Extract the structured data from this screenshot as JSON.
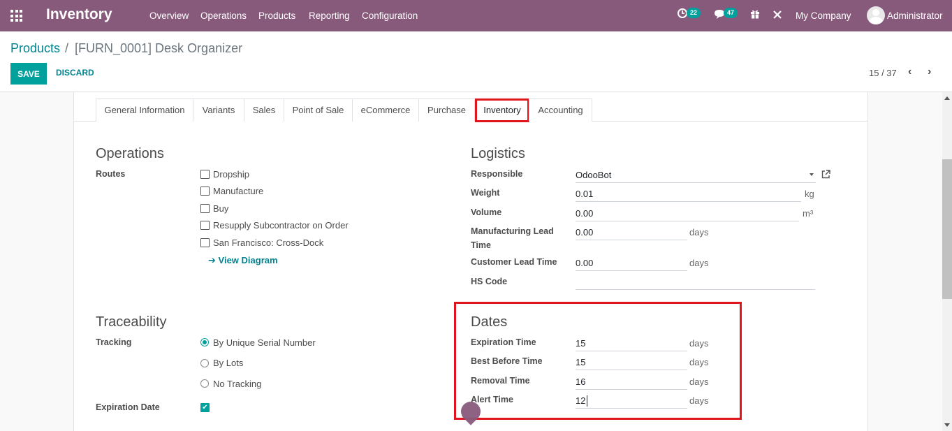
{
  "navbar": {
    "app_name": "Inventory",
    "menu": [
      "Overview",
      "Operations",
      "Products",
      "Reporting",
      "Configuration"
    ],
    "activity_badge": "22",
    "messages_badge": "47",
    "company": "My Company",
    "user": "Administrator"
  },
  "breadcrumb": {
    "parent": "Products",
    "separator": "/",
    "current": "[FURN_0001] Desk Organizer"
  },
  "buttons": {
    "save": "SAVE",
    "discard": "DISCARD"
  },
  "pager": {
    "text": "15 / 37",
    "prev": "‹",
    "next": "›"
  },
  "tabs": [
    "General Information",
    "Variants",
    "Sales",
    "Point of Sale",
    "eCommerce",
    "Purchase",
    "Inventory",
    "Accounting"
  ],
  "operations": {
    "title": "Operations",
    "routes_label": "Routes",
    "routes": [
      "Dropship",
      "Manufacture",
      "Buy",
      "Resupply Subcontractor on Order",
      "San Francisco: Cross-Dock"
    ],
    "view_diagram": "View Diagram"
  },
  "logistics": {
    "title": "Logistics",
    "responsible_label": "Responsible",
    "responsible_value": "OdooBot",
    "weight_label": "Weight",
    "weight_value": "0.01",
    "weight_unit": "kg",
    "volume_label": "Volume",
    "volume_value": "0.00",
    "volume_unit": "m³",
    "mfg_lead_label_1": "Manufacturing Lead",
    "mfg_lead_label_2": "Time",
    "mfg_lead_value": "0.00",
    "mfg_lead_unit": "days",
    "customer_lead_label": "Customer Lead Time",
    "customer_lead_value": "0.00",
    "customer_lead_unit": "days",
    "hs_code_label": "HS Code",
    "hs_code_value": ""
  },
  "traceability": {
    "title": "Traceability",
    "tracking_label": "Tracking",
    "options": [
      "By Unique Serial Number",
      "By Lots",
      "No Tracking"
    ],
    "selected": "By Unique Serial Number",
    "expiration_date_label": "Expiration Date"
  },
  "dates": {
    "title": "Dates",
    "expiration_label": "Expiration Time",
    "expiration_value": "15",
    "best_before_label": "Best Before Time",
    "best_before_value": "15",
    "removal_label": "Removal Time",
    "removal_value": "16",
    "alert_label": "Alert Time",
    "alert_value": "12",
    "unit": "days"
  },
  "colors": {
    "navbar": "#875a7b",
    "accent": "#00a09d",
    "link": "#00828f",
    "highlight": "#e0161e"
  }
}
